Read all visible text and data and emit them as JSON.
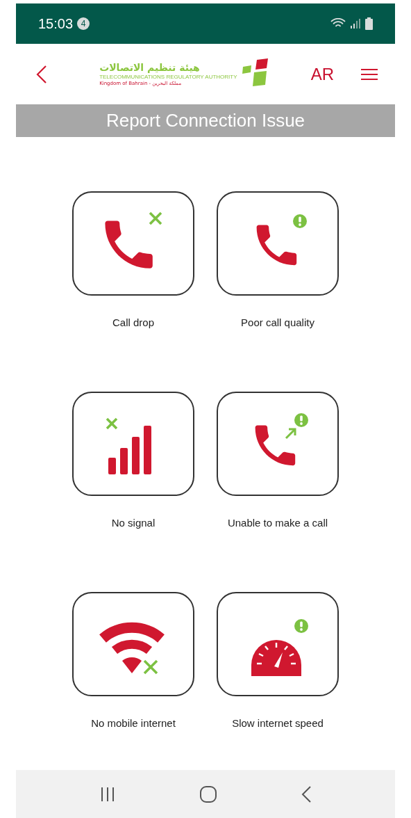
{
  "status_bar": {
    "time": "15:03",
    "notification_count": "4"
  },
  "header": {
    "logo": {
      "name_arabic": "هيئة تنظيم الاتصالات",
      "name_english": "TELECOMMUNICATIONS REGULATORY AUTHORITY",
      "country": "Kingdom of Bahrain - مملكة البحرين"
    },
    "language": "AR"
  },
  "title": "Report Connection Issue",
  "issues": [
    {
      "kind": "call_drop",
      "label": "Call drop"
    },
    {
      "kind": "poor_quality",
      "label": "Poor call quality"
    },
    {
      "kind": "no_signal",
      "label": "No signal"
    },
    {
      "kind": "unable_call",
      "label": "Unable to make a call"
    },
    {
      "kind": "no_internet",
      "label": "No mobile internet"
    },
    {
      "kind": "slow_speed",
      "label": "Slow internet speed"
    }
  ]
}
